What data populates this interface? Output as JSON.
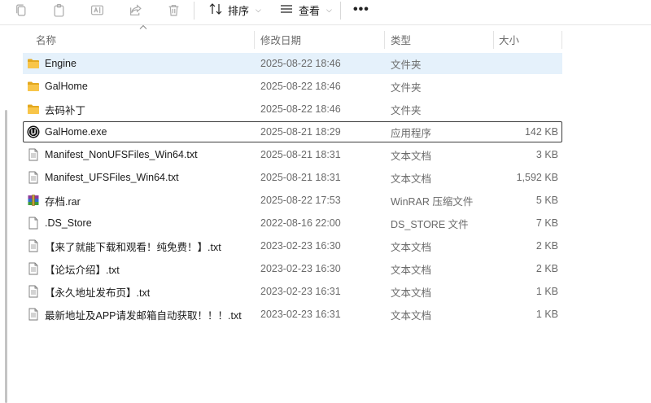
{
  "toolbar": {
    "sort_label": "排序",
    "view_label": "查看",
    "more_label": "•••"
  },
  "columns": {
    "name": "名称",
    "date": "修改日期",
    "type": "类型",
    "size": "大小"
  },
  "files": [
    {
      "name": "Engine",
      "date": "2025-08-22 18:46",
      "type": "文件夹",
      "size": "",
      "icon": "folder-icon"
    },
    {
      "name": "GalHome",
      "date": "2025-08-22 18:46",
      "type": "文件夹",
      "size": "",
      "icon": "folder-icon"
    },
    {
      "name": "去码补丁",
      "date": "2025-08-22 18:46",
      "type": "文件夹",
      "size": "",
      "icon": "folder-icon"
    },
    {
      "name": "GalHome.exe",
      "date": "2025-08-21 18:29",
      "type": "应用程序",
      "size": "142 KB",
      "icon": "unreal-engine-icon"
    },
    {
      "name": "Manifest_NonUFSFiles_Win64.txt",
      "date": "2025-08-21 18:31",
      "type": "文本文档",
      "size": "3 KB",
      "icon": "text-file-icon"
    },
    {
      "name": "Manifest_UFSFiles_Win64.txt",
      "date": "2025-08-21 18:31",
      "type": "文本文档",
      "size": "1,592 KB",
      "icon": "text-file-icon"
    },
    {
      "name": "存档.rar",
      "date": "2025-08-22 17:53",
      "type": "WinRAR 压缩文件",
      "size": "5 KB",
      "icon": "winrar-archive-icon"
    },
    {
      "name": ".DS_Store",
      "date": "2022-08-16 22:00",
      "type": "DS_STORE 文件",
      "size": "7 KB",
      "icon": "blank-file-icon"
    },
    {
      "name": "【来了就能下载和观看！纯免费！】.txt",
      "date": "2023-02-23 16:30",
      "type": "文本文档",
      "size": "2 KB",
      "icon": "text-file-icon"
    },
    {
      "name": "【论坛介绍】.txt",
      "date": "2023-02-23 16:30",
      "type": "文本文档",
      "size": "2 KB",
      "icon": "text-file-icon"
    },
    {
      "name": "【永久地址发布页】.txt",
      "date": "2023-02-23 16:31",
      "type": "文本文档",
      "size": "1 KB",
      "icon": "text-file-icon"
    },
    {
      "name": "最新地址及APP请发邮箱自动获取！！！.txt",
      "date": "2023-02-23 16:31",
      "type": "文本文档",
      "size": "1 KB",
      "icon": "text-file-icon"
    }
  ],
  "selected_index": 0,
  "focused_index": 3,
  "colors": {
    "selection": "#e5f1fb",
    "folder": "#f8c549",
    "folder_dark": "#e3a81f"
  }
}
